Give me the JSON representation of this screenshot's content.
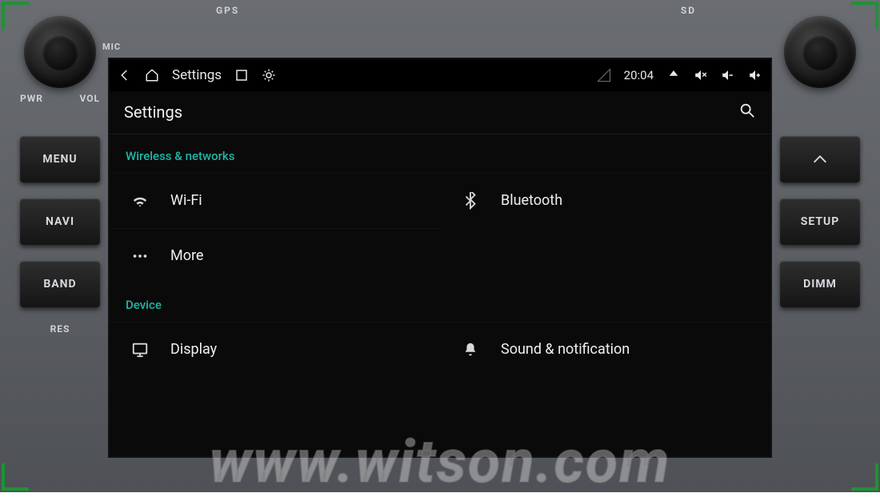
{
  "bezel": {
    "top_slots": {
      "gps": "GPS",
      "sd": "SD",
      "mic": "MIC"
    },
    "left": {
      "knob_labels": {
        "a": "PWR",
        "b": "VOL"
      },
      "buttons": [
        "MENU",
        "NAVI",
        "BAND"
      ],
      "bottom": "RES"
    },
    "right": {
      "buttons": [
        "SETUP",
        "DIMM"
      ]
    }
  },
  "statusbar": {
    "title": "Settings",
    "time": "20:04"
  },
  "header": {
    "title": "Settings"
  },
  "sections": [
    {
      "title": "Wireless & networks",
      "items": [
        {
          "icon": "wifi",
          "label": "Wi-Fi"
        },
        {
          "icon": "bluetooth",
          "label": "Bluetooth"
        },
        {
          "icon": "more",
          "label": "More"
        }
      ]
    },
    {
      "title": "Device",
      "items": [
        {
          "icon": "display",
          "label": "Display"
        },
        {
          "icon": "bell",
          "label": "Sound & notification"
        }
      ]
    }
  ],
  "watermark": "www.witson.com"
}
